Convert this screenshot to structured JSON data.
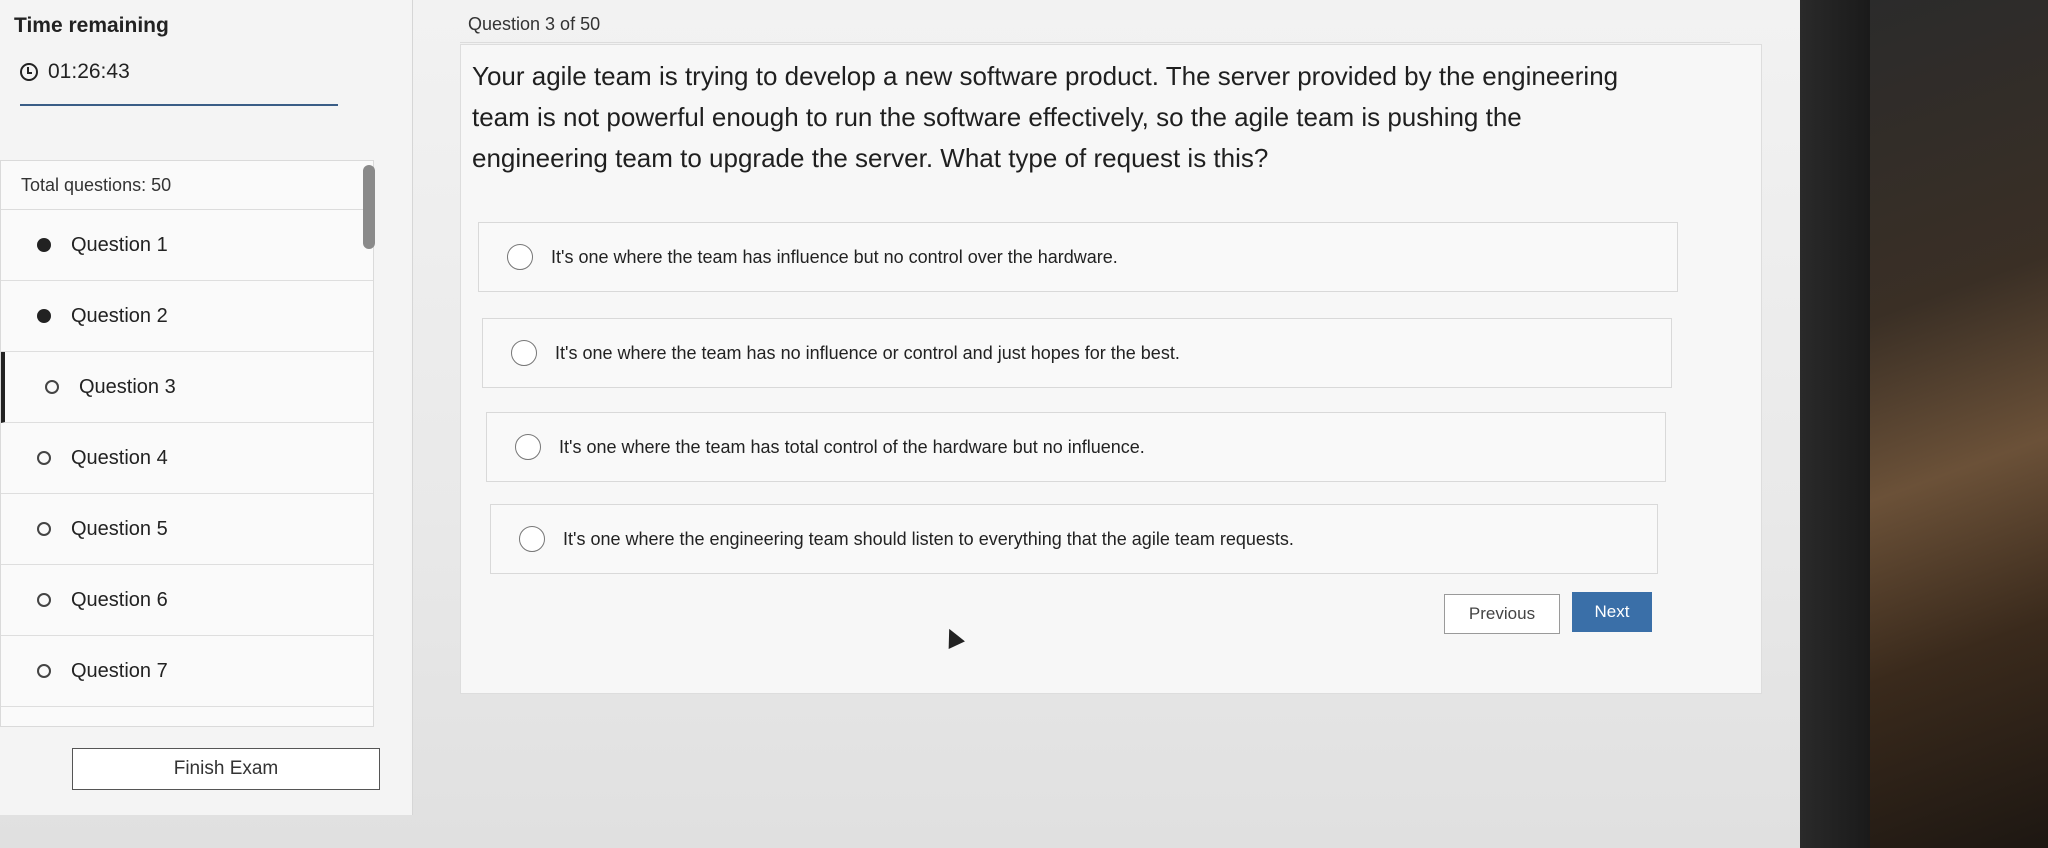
{
  "sidebar": {
    "time_label": "Time remaining",
    "timer": "01:26:43",
    "timer_progress": 1.0,
    "total_questions": "Total questions: 50",
    "questions": [
      {
        "label": "Question 1",
        "status": "answered"
      },
      {
        "label": "Question 2",
        "status": "answered"
      },
      {
        "label": "Question 3",
        "status": "current"
      },
      {
        "label": "Question 4",
        "status": "unanswered"
      },
      {
        "label": "Question 5",
        "status": "unanswered"
      },
      {
        "label": "Question 6",
        "status": "unanswered"
      },
      {
        "label": "Question 7",
        "status": "unanswered"
      }
    ],
    "finish_label": "Finish Exam"
  },
  "main": {
    "counter": "Question 3 of 50",
    "question_text": "Your agile team is trying to develop a new software product. The server provided by the engineering team is not powerful enough to run the software effectively, so the agile team is pushing the engineering team to upgrade the server. What type of request is this?",
    "options": [
      "It's one where the team has influence but no control over the hardware.",
      "It's one where the team has no influence or control and just hopes for the best.",
      "It's one where the team has total control of the hardware but no influence.",
      "It's one where the engineering team should listen to everything that the agile team requests."
    ],
    "previous_label": "Previous",
    "next_label": "Next"
  },
  "colors": {
    "accent": "#3a6fa8",
    "progress": "#3a5d86"
  }
}
